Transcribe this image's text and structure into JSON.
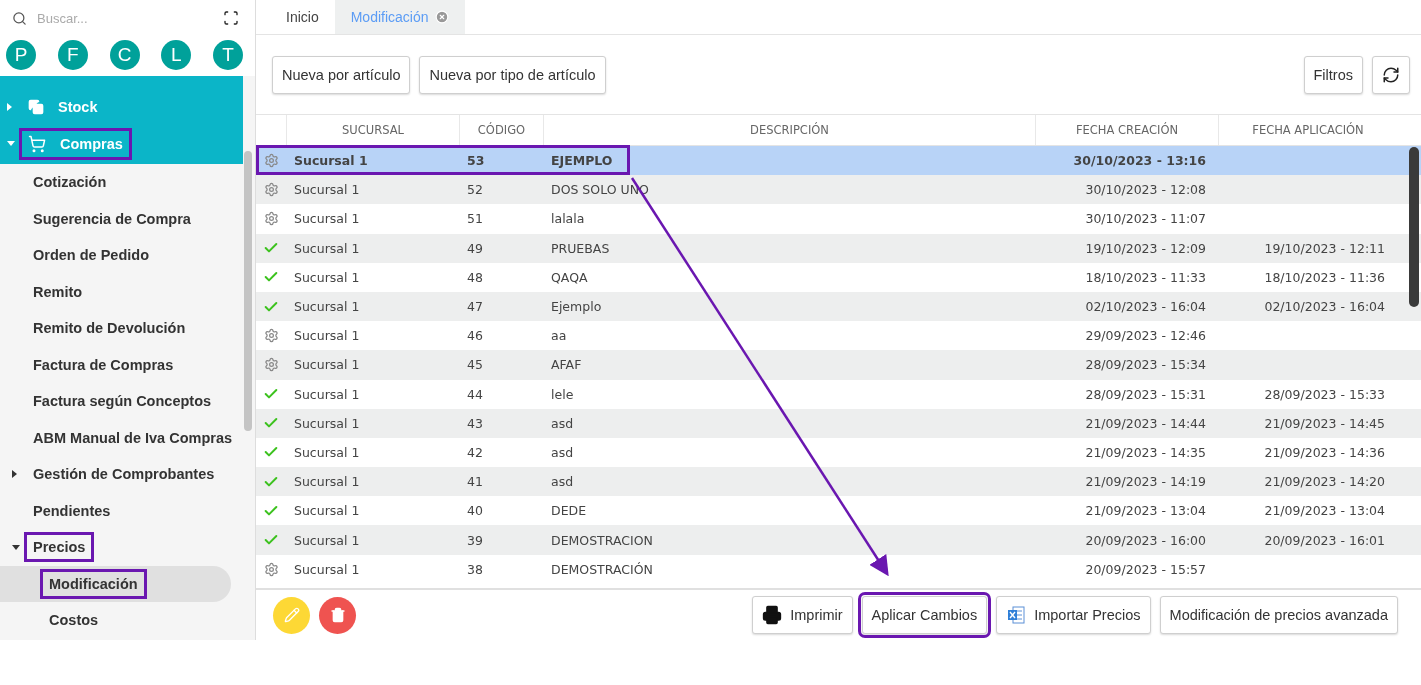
{
  "sidebar": {
    "search": {
      "placeholder": "Buscar..."
    },
    "shortcuts": [
      "P",
      "F",
      "C",
      "L",
      "T"
    ],
    "menu": [
      {
        "label": "Stock",
        "kind": "stock",
        "expanded": false,
        "selected": false,
        "highlighted": false
      },
      {
        "label": "Compras",
        "kind": "cart",
        "expanded": true,
        "selected": false,
        "highlighted": true,
        "children": [
          {
            "label": "Cotización",
            "selected": false,
            "highlighted": false
          },
          {
            "label": "Sugerencia de Compra",
            "selected": false,
            "highlighted": false
          },
          {
            "label": "Orden de Pedido",
            "selected": false,
            "highlighted": false
          },
          {
            "label": "Remito",
            "selected": false,
            "highlighted": false
          },
          {
            "label": "Remito de Devolución",
            "selected": false,
            "highlighted": false
          },
          {
            "label": "Factura de Compras",
            "selected": false,
            "highlighted": false
          },
          {
            "label": "Factura según Conceptos",
            "selected": false,
            "highlighted": false
          },
          {
            "label": "ABM Manual de Iva Compras",
            "selected": false,
            "highlighted": false
          },
          {
            "label": "Gestión de Comprobantes",
            "expanded": false,
            "selected": false,
            "highlighted": false
          },
          {
            "label": "Pendientes",
            "selected": false,
            "highlighted": false
          },
          {
            "label": "Precios",
            "expanded": true,
            "selected": false,
            "highlighted": true,
            "children": [
              {
                "label": "Modificación",
                "selected": true,
                "highlighted": true
              },
              {
                "label": "Costos",
                "selected": false,
                "highlighted": false
              }
            ]
          }
        ]
      }
    ]
  },
  "tabs": [
    {
      "label": "Inicio",
      "selected": false
    },
    {
      "label": "Modificación",
      "selected": true
    }
  ],
  "toolbar": {
    "left_buttons": [
      "Nueva por artículo",
      "Nueva por tipo de artículo"
    ],
    "filter_button": "Filtros"
  },
  "table": {
    "columns": [
      "SUCURSAL",
      "CÓDIGO",
      "DESCRIPCIÓN",
      "FECHA CREACIÓN",
      "FECHA APLICACIÓN"
    ],
    "rows": [
      {
        "kind": "pending",
        "cells": [
          "Sucursal 1",
          "53",
          "EJEMPLO",
          "30/10/2023 - 13:16",
          ""
        ],
        "selected": true,
        "highlighted": true
      },
      {
        "kind": "pending",
        "cells": [
          "Sucursal 1",
          "52",
          "DOS SOLO UNO",
          "30/10/2023 - 12:08",
          ""
        ],
        "selected": false,
        "highlighted": false
      },
      {
        "kind": "pending",
        "cells": [
          "Sucursal 1",
          "51",
          "lalala",
          "30/10/2023 - 11:07",
          ""
        ],
        "selected": false,
        "highlighted": false
      },
      {
        "kind": "applied",
        "cells": [
          "Sucursal 1",
          "49",
          "PRUEBAS",
          "19/10/2023 - 12:09",
          "19/10/2023 - 12:11"
        ],
        "selected": false,
        "highlighted": false
      },
      {
        "kind": "applied",
        "cells": [
          "Sucursal 1",
          "48",
          "QAQA",
          "18/10/2023 - 11:33",
          "18/10/2023 - 11:36"
        ],
        "selected": false,
        "highlighted": false
      },
      {
        "kind": "applied",
        "cells": [
          "Sucursal 1",
          "47",
          "Ejemplo",
          "02/10/2023 - 16:04",
          "02/10/2023 - 16:04"
        ],
        "selected": false,
        "highlighted": false
      },
      {
        "kind": "pending",
        "cells": [
          "Sucursal 1",
          "46",
          "aa",
          "29/09/2023 - 12:46",
          ""
        ],
        "selected": false,
        "highlighted": false
      },
      {
        "kind": "pending",
        "cells": [
          "Sucursal 1",
          "45",
          "AFAF",
          "28/09/2023 - 15:34",
          ""
        ],
        "selected": false,
        "highlighted": false
      },
      {
        "kind": "applied",
        "cells": [
          "Sucursal 1",
          "44",
          "lele",
          "28/09/2023 - 15:31",
          "28/09/2023 - 15:33"
        ],
        "selected": false,
        "highlighted": false
      },
      {
        "kind": "applied",
        "cells": [
          "Sucursal 1",
          "43",
          "asd",
          "21/09/2023 - 14:44",
          "21/09/2023 - 14:45"
        ],
        "selected": false,
        "highlighted": false
      },
      {
        "kind": "applied",
        "cells": [
          "Sucursal 1",
          "42",
          "asd",
          "21/09/2023 - 14:35",
          "21/09/2023 - 14:36"
        ],
        "selected": false,
        "highlighted": false
      },
      {
        "kind": "applied",
        "cells": [
          "Sucursal 1",
          "41",
          "asd",
          "21/09/2023 - 14:19",
          "21/09/2023 - 14:20"
        ],
        "selected": false,
        "highlighted": false
      },
      {
        "kind": "applied",
        "cells": [
          "Sucursal 1",
          "40",
          "DEDE",
          "21/09/2023 - 13:04",
          "21/09/2023 - 13:04"
        ],
        "selected": false,
        "highlighted": false
      },
      {
        "kind": "applied",
        "cells": [
          "Sucursal 1",
          "39",
          "DEMOSTRACION",
          "20/09/2023 - 16:00",
          "20/09/2023 - 16:01"
        ],
        "selected": false,
        "highlighted": false
      },
      {
        "kind": "pending",
        "cells": [
          "Sucursal 1",
          "38",
          "DEMOSTRACIÓN",
          "20/09/2023 - 15:57",
          ""
        ],
        "selected": false,
        "highlighted": false
      }
    ]
  },
  "footer": {
    "buttons": [
      {
        "label": "Imprimir",
        "kind": "print",
        "highlighted": false
      },
      {
        "label": "Aplicar Cambios",
        "kind": "apply",
        "highlighted": true
      },
      {
        "label": "Importar Precios",
        "kind": "import",
        "highlighted": false
      },
      {
        "label": "Modificación de precios avanzada",
        "kind": "advanced",
        "highlighted": false
      }
    ]
  }
}
